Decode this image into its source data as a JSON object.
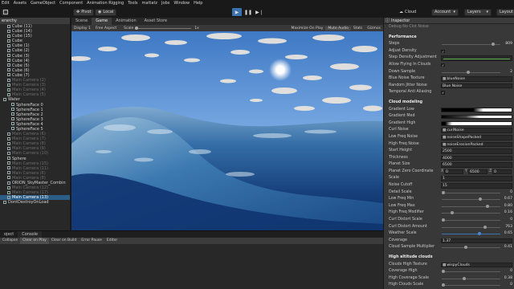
{
  "menu": [
    "Edit",
    "Assets",
    "GameObject",
    "Component",
    "Animation Rigging",
    "Tools",
    "mattatz",
    "Jobs",
    "Window",
    "Help"
  ],
  "toolbar": {
    "pivot": "Pivot",
    "local": "Local",
    "cloud": "Cloud",
    "account": "Account",
    "layers": "Layers",
    "layout": "Layout"
  },
  "hierarchy": {
    "tab": "erarchy",
    "rows": [
      {
        "label": "Cube (11)",
        "indent": 1,
        "state": "normal"
      },
      {
        "label": "Cube (14)",
        "indent": 1,
        "state": "normal"
      },
      {
        "label": "Cube (15)",
        "indent": 1,
        "state": "normal"
      },
      {
        "label": "Cube",
        "indent": 1,
        "state": "normal"
      },
      {
        "label": "Cube (1)",
        "indent": 1,
        "state": "normal"
      },
      {
        "label": "Cube (2)",
        "indent": 1,
        "state": "normal"
      },
      {
        "label": "Cube (3)",
        "indent": 1,
        "state": "normal"
      },
      {
        "label": "Cube (4)",
        "indent": 1,
        "state": "normal"
      },
      {
        "label": "Cube (5)",
        "indent": 1,
        "state": "normal"
      },
      {
        "label": "Cube (6)",
        "indent": 1,
        "state": "normal"
      },
      {
        "label": "Cube (7)",
        "indent": 1,
        "state": "normal"
      },
      {
        "label": "Main Camera (2)",
        "indent": 1,
        "state": "dim"
      },
      {
        "label": "Main Camera (3)",
        "indent": 1,
        "state": "dim"
      },
      {
        "label": "Main Camera (4)",
        "indent": 1,
        "state": "dim"
      },
      {
        "label": "Main Camera (5)",
        "indent": 1,
        "state": "dim"
      },
      {
        "label": "Water",
        "indent": 0,
        "state": "normal"
      },
      {
        "label": "SphereFace 0",
        "indent": 2,
        "state": "normal"
      },
      {
        "label": "SphereFace 1",
        "indent": 2,
        "state": "normal"
      },
      {
        "label": "SphereFace 2",
        "indent": 2,
        "state": "normal"
      },
      {
        "label": "SphereFace 3",
        "indent": 2,
        "state": "normal"
      },
      {
        "label": "SphereFace 4",
        "indent": 2,
        "state": "normal"
      },
      {
        "label": "SphereFace 5",
        "indent": 2,
        "state": "normal"
      },
      {
        "label": "Main Camera (6)",
        "indent": 1,
        "state": "dim"
      },
      {
        "label": "Main Camera (7)",
        "indent": 1,
        "state": "dim"
      },
      {
        "label": "Main Camera (8)",
        "indent": 1,
        "state": "dim"
      },
      {
        "label": "Main Camera (9)",
        "indent": 1,
        "state": "dim"
      },
      {
        "label": "Main Camera (10)",
        "indent": 1,
        "state": "dim"
      },
      {
        "label": "Sphere",
        "indent": 1,
        "state": "normal"
      },
      {
        "label": "Main Camera (15)",
        "indent": 1,
        "state": "dim"
      },
      {
        "label": "Main Camera (11)",
        "indent": 1,
        "state": "dim"
      },
      {
        "label": "Main Camera (6)",
        "indent": 1,
        "state": "dim"
      },
      {
        "label": "Main Camera (8)",
        "indent": 1,
        "state": "dim"
      },
      {
        "label": "ORION_SkyMaster_Combin",
        "indent": 1,
        "state": "normal"
      },
      {
        "label": "Main Camera (12)",
        "indent": 1,
        "state": "dim"
      },
      {
        "label": "Main Camera (17)",
        "indent": 1,
        "state": "dim"
      },
      {
        "label": "Main Camera (13)",
        "indent": 1,
        "state": "sel"
      },
      {
        "label": "DontDestroyOnLoad",
        "indent": 0,
        "state": "normal"
      }
    ]
  },
  "game": {
    "tabs": [
      "Scene",
      "Game",
      "Animation",
      "Asset Store"
    ],
    "display": "Display 1",
    "aspect": "Free Aspect",
    "scale_label": "Scale",
    "scale_value": "1x",
    "options": [
      "Maximize On Play",
      "Mute Audio",
      "Stats",
      "Gizmos"
    ]
  },
  "console": {
    "tabs": [
      "oject",
      "Console"
    ],
    "buttons": [
      "Collapse",
      "Clear on Play",
      "Clear on Build",
      "Error Pause",
      "Editor"
    ]
  },
  "inspector": {
    "tab": "Inspector",
    "rows": [
      {
        "kind": "label",
        "label": "Debug No Clot Noise"
      },
      {
        "kind": "gap"
      },
      {
        "kind": "head",
        "label": "Performance"
      },
      {
        "kind": "slider",
        "label": "Steps",
        "value": "809",
        "pos": 0.9
      },
      {
        "kind": "check",
        "label": "Adjust Density",
        "checked": true
      },
      {
        "kind": "curve",
        "label": "Step Density Adjustment"
      },
      {
        "kind": "check",
        "label": "Allow Flying In Clouds",
        "checked": true
      },
      {
        "kind": "slider",
        "label": "Down Sample",
        "value": "2",
        "pos": 0.45
      },
      {
        "kind": "field",
        "label": "Blue Noise Texture",
        "value": "blueNoise",
        "icon": true
      },
      {
        "kind": "field",
        "label": "Random Jitter Noise",
        "value": "Blue Noise",
        "icon": false
      },
      {
        "kind": "check",
        "label": "Temporal Anti Aliasing",
        "checked": true
      },
      {
        "kind": "gap"
      },
      {
        "kind": "head",
        "label": "Cloud modeling"
      },
      {
        "kind": "gradient",
        "label": "Gradient Low",
        "grad": "linear-gradient(90deg,#000 0%,#000 45%,#fff 60%,#fff 100%)"
      },
      {
        "kind": "gradient",
        "label": "Gradient Med",
        "grad": "linear-gradient(90deg,#000 0%,#444 35%,#fff 55%,#fff 100%)"
      },
      {
        "kind": "gradient",
        "label": "Gradient High",
        "grad": "linear-gradient(90deg,#000 0%,#000 5%,#fff 15%,#fff 100%)"
      },
      {
        "kind": "field",
        "label": "Curl Noise",
        "value": "curlNoise",
        "icon": true
      },
      {
        "kind": "field",
        "label": "Low Freq Noise",
        "value": "noiseShapePacked",
        "icon": true
      },
      {
        "kind": "field",
        "label": "High Freq Noise",
        "value": "noiseErosionPacked",
        "icon": true
      },
      {
        "kind": "text",
        "label": "Start Height",
        "value": "2500"
      },
      {
        "kind": "text",
        "label": "Thickness",
        "value": "4000"
      },
      {
        "kind": "text",
        "label": "Planet Size",
        "value": "6500"
      },
      {
        "kind": "xy",
        "label": "Planet Zero Coordinate",
        "x": "0",
        "y": "6500",
        "z": "0"
      },
      {
        "kind": "text",
        "label": "Scale",
        "value": "1"
      },
      {
        "kind": "text",
        "label": "Noise Cutoff",
        "value": "15"
      },
      {
        "kind": "slider",
        "label": "Detail Scale",
        "value": "0",
        "pos": 0.0
      },
      {
        "kind": "slider",
        "label": "Low Freq Min",
        "value": "0.67",
        "pos": 0.67
      },
      {
        "kind": "slider",
        "label": "Low Freq Max",
        "value": "0.80",
        "pos": 0.8
      },
      {
        "kind": "slider",
        "label": "High Freq Modifier",
        "value": "0.16",
        "pos": 0.16
      },
      {
        "kind": "slider",
        "label": "Curl Distort Scale",
        "value": "0",
        "pos": 0.0
      },
      {
        "kind": "slider",
        "label": "Curl Distort Amount",
        "value": "763",
        "pos": 0.76
      },
      {
        "kind": "slider",
        "label": "Weather Scale",
        "value": "0.65",
        "pos": 0.65,
        "active": true
      },
      {
        "kind": "text",
        "label": "Coverage",
        "value": "1.37"
      },
      {
        "kind": "slider",
        "label": "Cloud Sample Multiplier",
        "value": "0.41",
        "pos": 0.41
      },
      {
        "kind": "gap"
      },
      {
        "kind": "head",
        "label": "High altitude clouds"
      },
      {
        "kind": "field",
        "label": "Clouds High Texture",
        "value": "wispyClouds",
        "icon": true
      },
      {
        "kind": "slider",
        "label": "Coverage High",
        "value": "0",
        "pos": 0.0
      },
      {
        "kind": "slider",
        "label": "High Coverage Scale",
        "value": "0.38",
        "pos": 0.38
      },
      {
        "kind": "slider",
        "label": "High Clouds Scale",
        "value": "0",
        "pos": 0.0
      }
    ]
  },
  "colors": {
    "accent": "#2c5d87",
    "panel": "#383838",
    "play_active": "#3a72b0"
  }
}
